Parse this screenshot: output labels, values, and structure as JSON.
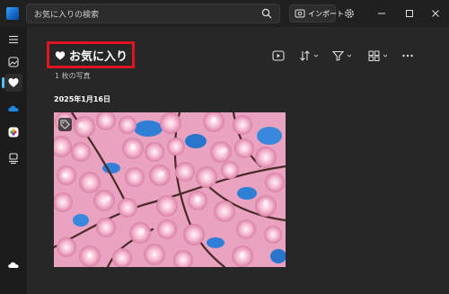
{
  "search": {
    "placeholder": "お気に入りの検索"
  },
  "toolbar": {
    "import_label": "インポート"
  },
  "page": {
    "title": "お気に入り",
    "photo_count": "1 枚の写真",
    "date_group": "2025年1月16日"
  },
  "icons": {
    "app": "photos-app-icon",
    "search": "search-icon",
    "import": "import-icon",
    "settings": "gear-icon",
    "minimize": "minimize-icon",
    "maximize": "maximize-icon",
    "close": "close-icon",
    "menu": "hamburger-icon",
    "gallery": "gallery-icon",
    "favorites": "heart-icon",
    "onedrive": "cloud-icon",
    "icloud": "icloud-photos-icon",
    "devices": "device-icon",
    "account": "cloud-account-icon",
    "slideshow": "slideshow-icon",
    "sort": "sort-icon",
    "filter": "filter-icon",
    "view": "view-layout-icon",
    "more": "more-icon",
    "photo_badge": "tag-icon"
  },
  "colors": {
    "accent": "#4cc2ff",
    "highlight_border": "#e0141e",
    "background": "#272727"
  }
}
